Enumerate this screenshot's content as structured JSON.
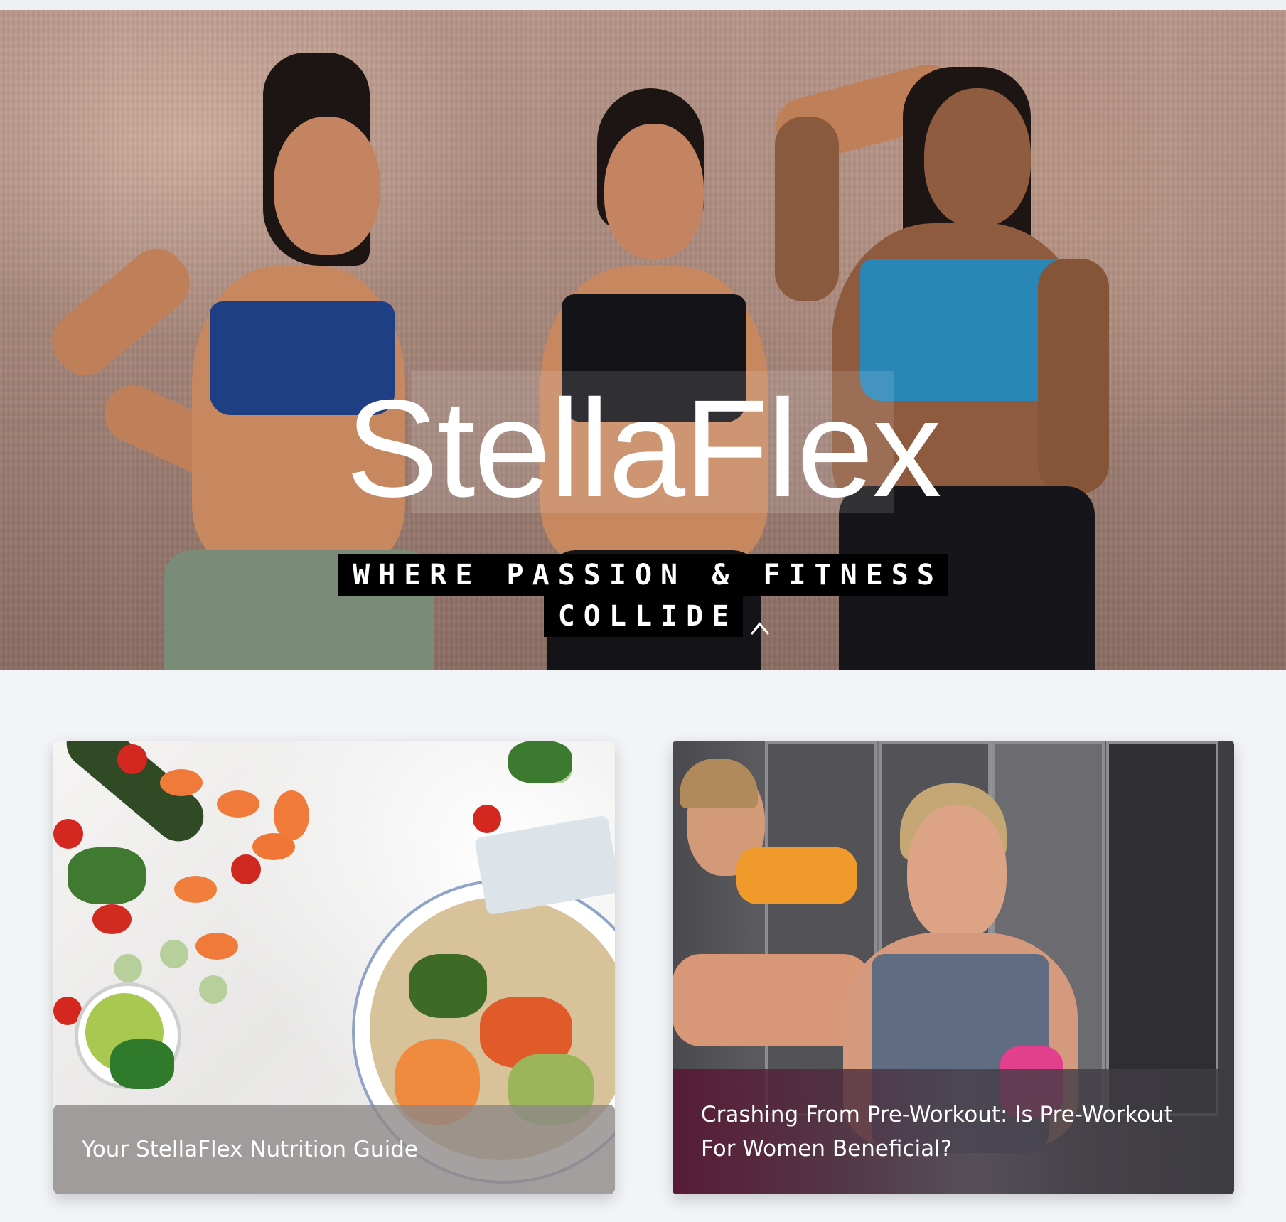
{
  "hero": {
    "brand_title": "StellaFlex",
    "tagline_line1": "WHERE PASSION & FITNESS",
    "tagline_line2": "COLLIDE"
  },
  "cards": [
    {
      "image_subject": "healthy food bowl with vegetables",
      "caption": "Your StellaFlex Nutrition Guide"
    },
    {
      "image_subject": "women drinking pre-workout in gym locker room",
      "caption": "Crashing From Pre-Workout: Is Pre-Workout For Women Beneficial?"
    }
  ],
  "colors": {
    "page_bg": "#f2f4f7",
    "hero_text": "#ffffff",
    "tagline_bg": "#000000"
  }
}
